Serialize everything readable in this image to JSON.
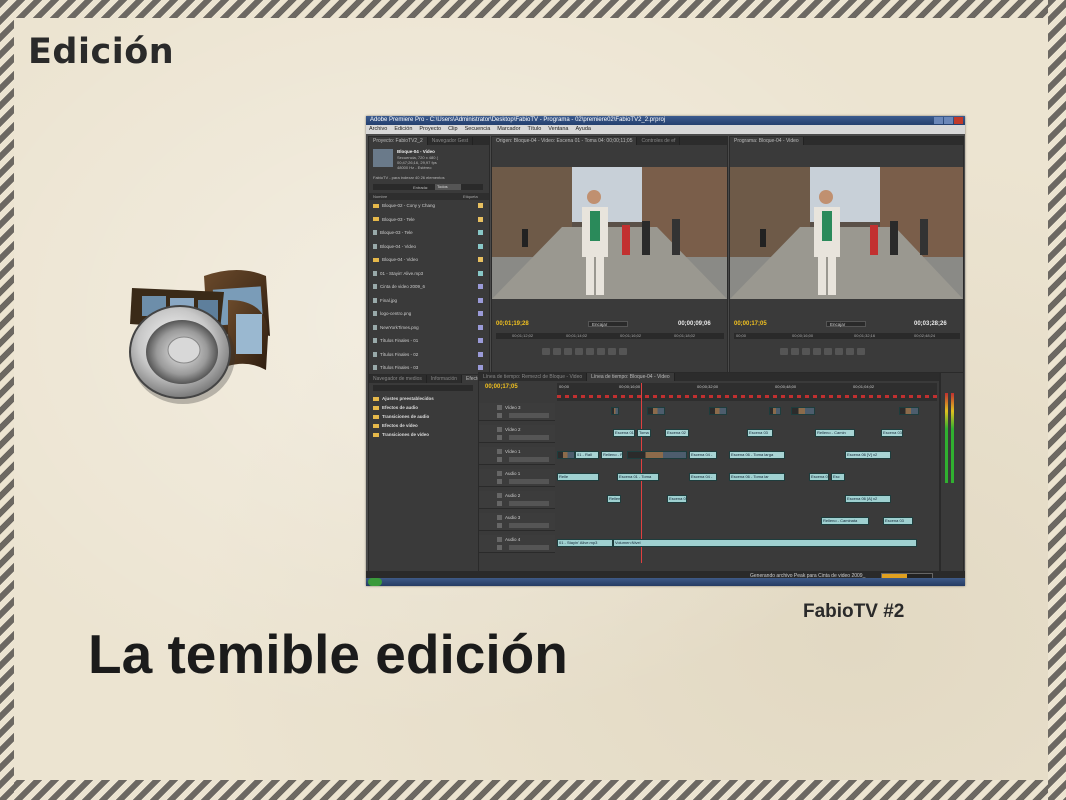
{
  "slide": {
    "title": "Edición",
    "headline": "La temible edición",
    "caption": "FabioTV #2"
  },
  "icon": {
    "name": "media-filmstrip-speaker-icon"
  },
  "premiere": {
    "window_title": "Adobe Premiere Pro - C:\\Users\\Administrator\\Desktop\\FabioTV - Programa - 02\\premiere02\\FabioTV2_2.prproj",
    "menu": [
      "Archivo",
      "Edición",
      "Proyecto",
      "Clip",
      "Secuencia",
      "Marcador",
      "Título",
      "Ventana",
      "Ayuda"
    ],
    "project_tabs": [
      "Proyecto: FabioTV2_2",
      "Navegador Gest"
    ],
    "project_info": {
      "name": "Bloque-04 - Video",
      "line1": "Secuencia, 720 x 480 (",
      "line2": "00;47;26;16, 29,97 fps",
      "line3": "48000 Hz - Estéreo",
      "count": "FabioTV - para indexar 40    26 elementos",
      "entrada_label": "Entrada:",
      "entrada_value": "Todos",
      "col_name": "Nombre",
      "col_label": "Etiqueta"
    },
    "project_items": [
      {
        "label": "Bloque-02 - Cony y Chang",
        "kind": "folder",
        "color": "#e8c060"
      },
      {
        "label": "Bloque-03 - Tele",
        "kind": "folder",
        "color": "#e8c060"
      },
      {
        "label": "Bloque-03 - Tele",
        "kind": "file",
        "color": "#88c8c8"
      },
      {
        "label": "Bloque-04 - Video",
        "kind": "file",
        "color": "#88c8c8"
      },
      {
        "label": "Bloque-04 - Video",
        "kind": "folder",
        "color": "#e8c060"
      },
      {
        "label": "01 - Stayin' Alive.mp3",
        "kind": "file",
        "color": "#88c8c8"
      },
      {
        "label": "Cinta de video 2009_6",
        "kind": "file",
        "color": "#9a9ad8"
      },
      {
        "label": "Final.jpg",
        "kind": "file",
        "color": "#9a9ad8"
      },
      {
        "label": "logo-centro.png",
        "kind": "file",
        "color": "#9a9ad8"
      },
      {
        "label": "NewYorkTimes.png",
        "kind": "file",
        "color": "#9a9ad8"
      },
      {
        "label": "Títulos Finales - 01",
        "kind": "file",
        "color": "#9a9ad8"
      },
      {
        "label": "Títulos Finales - 02",
        "kind": "file",
        "color": "#9a9ad8"
      },
      {
        "label": "Títulos Finales - 03",
        "kind": "file",
        "color": "#9a9ad8"
      }
    ],
    "source_monitor": {
      "tabs": [
        "Origen: Bloque-04 - Video: Escena 01 - Toma 04: 00;00;11;05",
        "Controles de ef"
      ],
      "tc_left": "00;01;19;28",
      "fit": "Encajar",
      "tc_right": "00;00;09;06",
      "ruler": [
        "00;01;12;02",
        "00;01;14;02",
        "00;01;16;02",
        "00;01;18;02"
      ]
    },
    "program_monitor": {
      "tabs": [
        "Programa: Bloque-04 - Video"
      ],
      "tc_left": "00;00;17;05",
      "fit": "Encajar",
      "tc_right": "00;03;28;26",
      "ruler": [
        "00;00",
        "00;00;16;00",
        "00;01;32;16",
        "00;02;48;24"
      ]
    },
    "effects": {
      "tabs": [
        "Navegador de medios",
        "Información",
        "Efectos"
      ],
      "items": [
        "Ajustes preestablecidos",
        "Efectos de audio",
        "Transiciones de audio",
        "Efectos de vídeo",
        "Transiciones de vídeo"
      ]
    },
    "timeline": {
      "tabs": [
        "Línea de tiempo: Remezcl de Bloque - Video",
        "Línea de tiempo: Bloque-04 - Video"
      ],
      "timecode": "00;00;17;05",
      "ruler": [
        "00;00",
        "00;00;16;00",
        "00;00;32;00",
        "00;00;48;00",
        "00;01;04;02"
      ],
      "tracks": [
        "Vídeo 3",
        "Vídeo 2",
        "Vídeo 1",
        "Audio 1",
        "Audio 2",
        "Audio 3",
        "Audio 4"
      ],
      "clip_labels": {
        "v2a": "Escena 01",
        "v2b": "Toma",
        "v2c": "Escena 02",
        "v2d": "Escena 03",
        "v2e": "Relleno - Camin",
        "v2f": "Escena 03",
        "v1a": "01 - Rall",
        "v1b": "Relleno - Relle",
        "v1c": "Escena 04 -",
        "v1d": "Escena 06 - Toma larga",
        "v1e": "Escena 06 [V] x2",
        "a1a": "Relle",
        "a1b": "Escena 01 - Toma",
        "a1c": "Escena 04 -",
        "a1d": "Escena 06 - Toma lar",
        "a1e": "Escena 0",
        "a1f": "Esc",
        "a2a": "Relleno",
        "a2b": "Escena 0",
        "a2c": "Escena 06 [A] x2",
        "a3a": "Relleno - Caminata",
        "a3b": "Escena 03",
        "a4a": "01 - Stayin' Alive.mp3",
        "a4b": "Volumen:Nivel"
      }
    },
    "status": "Generando archivo Peak para Cinta de video 2009_",
    "progress": 0.5
  }
}
